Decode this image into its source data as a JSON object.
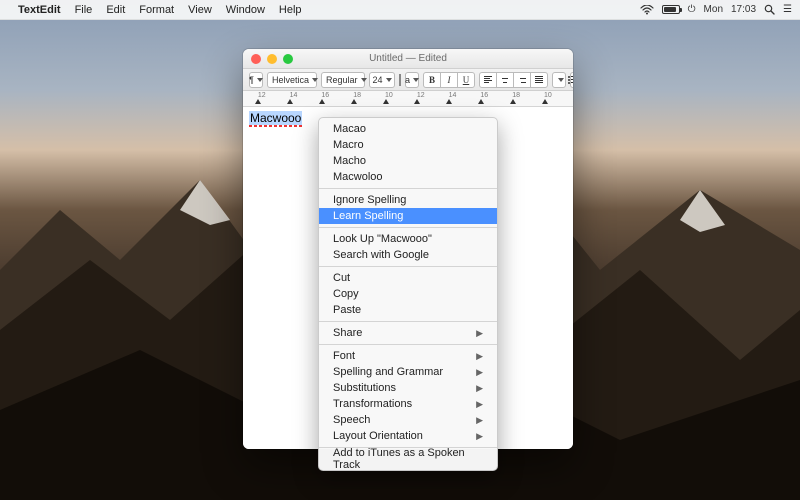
{
  "menubar": {
    "app": "TextEdit",
    "items": [
      "File",
      "Edit",
      "Format",
      "View",
      "Window",
      "Help"
    ],
    "day": "Mon",
    "time": "17:03",
    "battery_pct_fill": 70
  },
  "window": {
    "title": "Untitled — Edited",
    "font_family": "Helvetica",
    "font_style": "Regular",
    "font_size": "24",
    "bold": "B",
    "italic": "I",
    "underline": "U",
    "ruler_numbers": [
      "12",
      "14",
      "16",
      "18",
      "10",
      "12",
      "14",
      "16",
      "18",
      "10"
    ],
    "typed_text": "Macwooo"
  },
  "context_menu": {
    "suggestions": [
      "Macao",
      "Macro",
      "Macho",
      "Macwoloo"
    ],
    "ignore": "Ignore Spelling",
    "learn": "Learn Spelling",
    "lookup": "Look Up \"Macwooo\"",
    "search": "Search with Google",
    "cut": "Cut",
    "copy": "Copy",
    "paste": "Paste",
    "share": "Share",
    "font": "Font",
    "spelling": "Spelling and Grammar",
    "subs": "Substitutions",
    "trans": "Transformations",
    "speech": "Speech",
    "layout": "Layout Orientation",
    "itunes": "Add to iTunes as a Spoken Track"
  }
}
